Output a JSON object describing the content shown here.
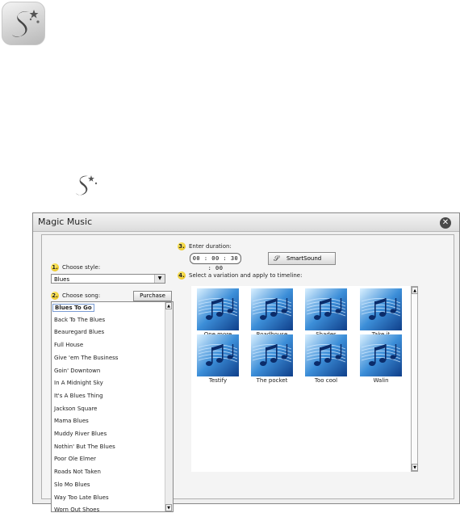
{
  "window": {
    "title": "Magic Music"
  },
  "steps": {
    "style": {
      "num": "1.",
      "label": "Choose style:"
    },
    "song": {
      "num": "2.",
      "label": "Choose song:"
    },
    "duration": {
      "num": "3.",
      "label": "Enter duration:"
    },
    "variation": {
      "num": "4.",
      "label": "Select a variation and apply to timeline:"
    }
  },
  "style_select": {
    "value": "Blues"
  },
  "purchase_label": "Purchase",
  "duration_value": "00 : 00 : 30 : 00",
  "smartsound_label": "SmartSound",
  "songs": [
    "Blues To Go",
    "Back To The Blues",
    "Beauregard Blues",
    "Full House",
    "Give 'em The Business",
    "Goin' Downtown",
    "In A Midnight Sky",
    "It's A Blues Thing",
    "Jackson Square",
    "Mama Blues",
    "Muddy River Blues",
    "Nothin' But The Blues",
    "Poor Ole Elmer",
    "Roads Not Taken",
    "Slo Mo Blues",
    "Way Too Late Blues",
    "Worn Out Shoes"
  ],
  "selected_song": "Blues To Go",
  "variations": [
    "One more",
    "Roadhouse",
    "Shades",
    "Take it",
    "Testify",
    "The pocket",
    "Too cool",
    "Walin"
  ],
  "icons": {
    "app": "smartsound-logo-icon",
    "close": "close-icon",
    "thumbnail": "music-notes-icon"
  }
}
